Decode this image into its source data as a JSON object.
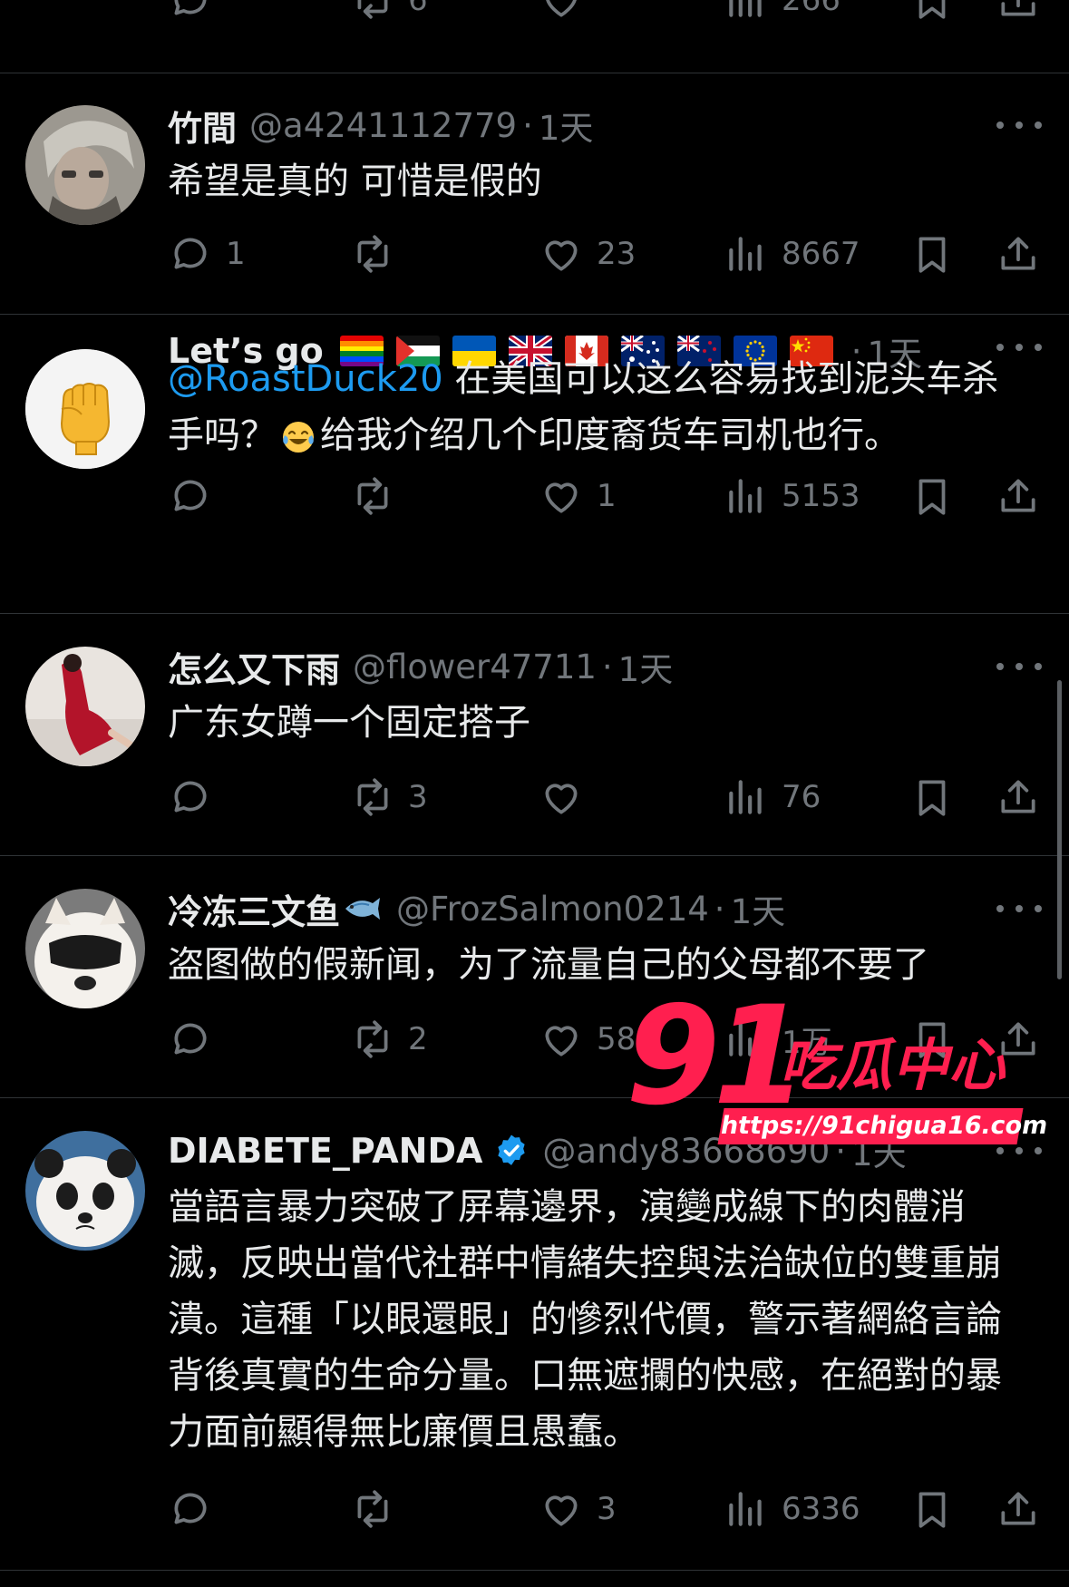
{
  "top_partial": {
    "retweets": "6",
    "views": "266"
  },
  "tweets": [
    {
      "name": "竹間",
      "handle": "@a4241112779",
      "time": "1天",
      "text": "希望是真的 可惜是假的",
      "replies": "1",
      "retweets": "",
      "likes": "23",
      "views": "8667"
    },
    {
      "name": "Let’s go",
      "flags": [
        "rainbow-flag",
        "palestine-flag",
        "ukraine-flag",
        "uk-flag",
        "canada-flag",
        "australia-flag",
        "new-zealand-flag",
        "eu-flag",
        "china-flag"
      ],
      "time": "1天",
      "mention": "@RoastDuck20",
      "text_part1": " 在美国可以这么容易找到泥头车杀手吗？",
      "emoji": "laughing-tears-emoji",
      "text_part2": "给我介绍几个印度裔货车司机也行。",
      "replies": "",
      "retweets": "",
      "likes": "1",
      "views": "5153"
    },
    {
      "name": "怎么又下雨",
      "handle": "@flower47711",
      "time": "1天",
      "text": "广东女蹲一个固定搭子",
      "replies": "",
      "retweets": "3",
      "likes": "",
      "views": "76"
    },
    {
      "name": "冷冻三文鱼",
      "name_emoji": "fish-emoji",
      "handle": "@FrozSalmon0214",
      "time": "1天",
      "text": "盗图做的假新闻，为了流量自己的父母都不要了",
      "replies": "",
      "retweets": "2",
      "likes": "58",
      "views": "1万"
    },
    {
      "name": "DIABETE_PANDA",
      "verified": true,
      "handle": "@andy83668690",
      "time": "1天",
      "text": "當語言暴力突破了屏幕邊界，演變成線下的肉體消滅，反映出當代社群中情緒失控與法治缺位的雙重崩潰。這種「以眼還眼」的慘烈代價，警示著網絡言論背後真實的生命分量。口無遮攔的快感，在絕對的暴力面前顯得無比廉價且愚蠢。",
      "replies": "",
      "retweets": "",
      "likes": "3",
      "views": "6336"
    }
  ],
  "watermark": {
    "number": "91",
    "title": "吃瓜中心",
    "url": "https://91chigua16.com"
  },
  "colors": {
    "background": "#000000",
    "text": "#e7e9ea",
    "muted": "#71767b",
    "link": "#1d9bf0",
    "divider": "#2f3336",
    "watermark": "#ff1f4f"
  }
}
